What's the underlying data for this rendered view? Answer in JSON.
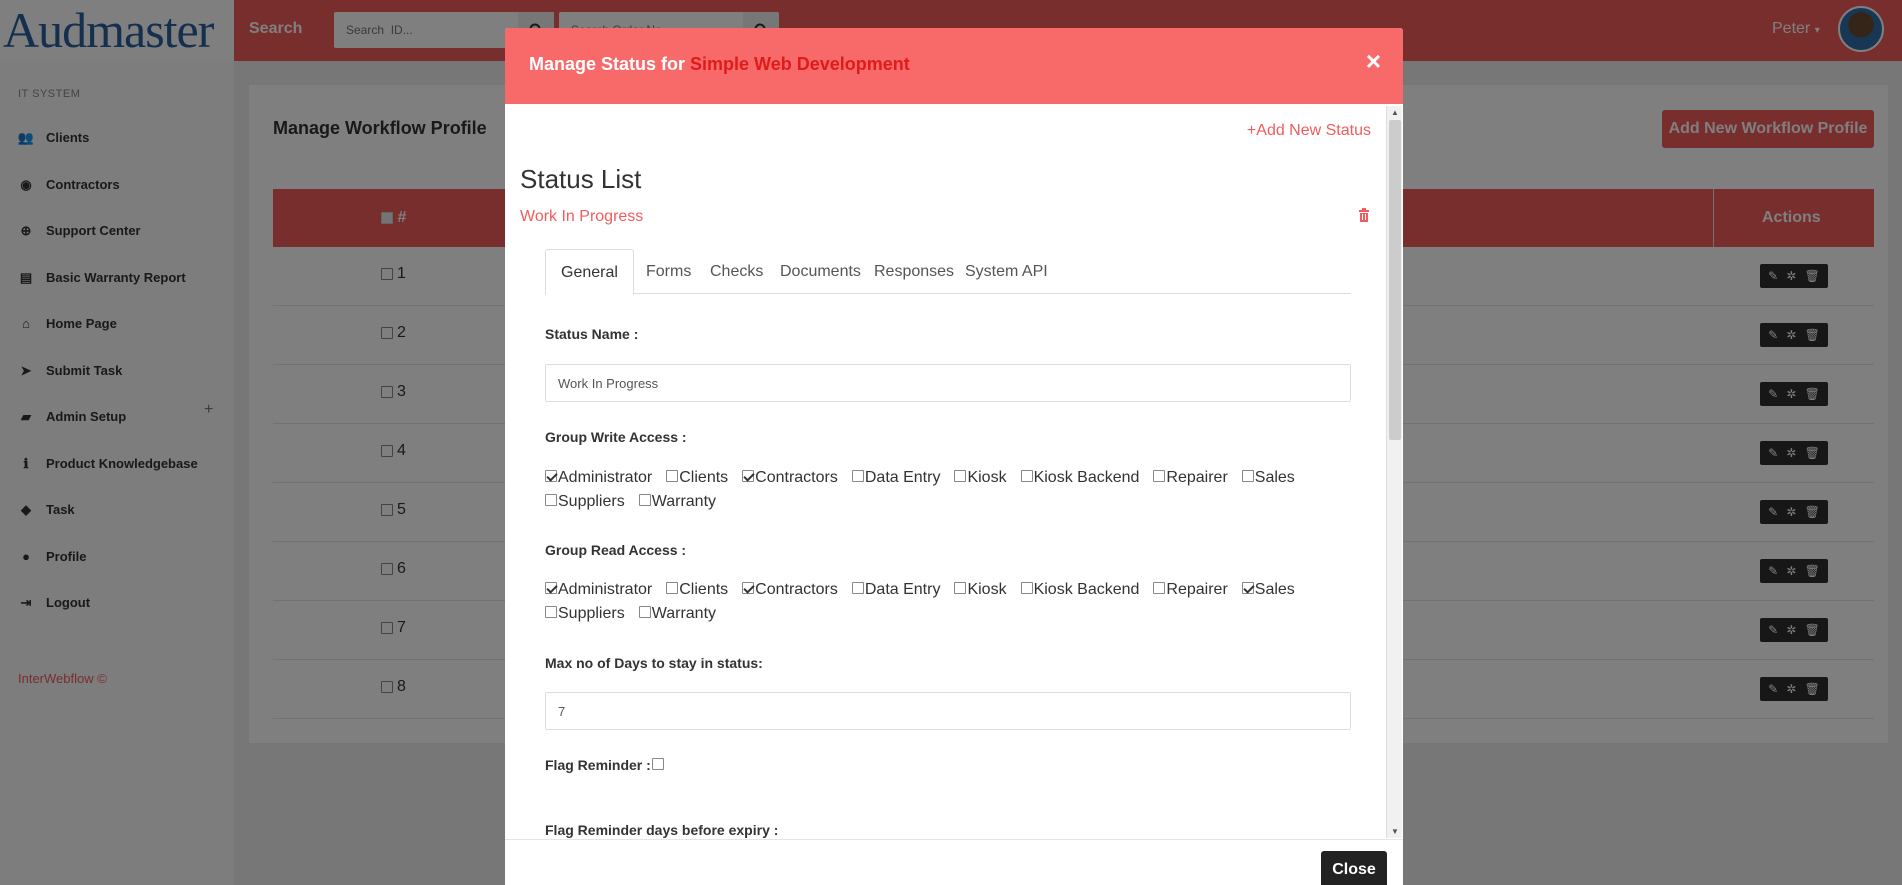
{
  "app": {
    "logo_text": "Audmaster"
  },
  "topbar": {
    "search_label": "Search",
    "search_id_placeholder": "Search  ID...",
    "search_order_placeholder": "Search Order No",
    "user_name": "Peter"
  },
  "sidebar": {
    "heading": "IT SYSTEM",
    "items": [
      {
        "label": "Clients",
        "icon": "users-icon"
      },
      {
        "label": "Contractors",
        "icon": "user-circle-icon"
      },
      {
        "label": "Support Center",
        "icon": "life-ring-icon"
      },
      {
        "label": "Basic Warranty Report",
        "icon": "file-icon"
      },
      {
        "label": "Home Page",
        "icon": "home-icon"
      },
      {
        "label": "Submit Task",
        "icon": "paper-plane-icon"
      },
      {
        "label": "Admin Setup",
        "icon": "folder-icon"
      },
      {
        "label": "Product Knowledgebase",
        "icon": "info-icon"
      },
      {
        "label": "Task",
        "icon": "tag-icon"
      },
      {
        "label": "Profile",
        "icon": "user-icon"
      },
      {
        "label": "Logout",
        "icon": "sign-out-icon"
      }
    ],
    "expand_symbol": "+",
    "footer": "InterWebflow ©"
  },
  "main": {
    "title": "Manage Workflow Profile",
    "add_button": "Add New Workflow Profile",
    "columns": {
      "num": "#",
      "actions": "Actions"
    },
    "rows": [
      "1",
      "2",
      "3",
      "4",
      "5",
      "6",
      "7",
      "8"
    ]
  },
  "modal": {
    "title_prefix": "Manage Status for ",
    "title_project": "Simple Web Development",
    "close_symbol": "×",
    "add_status": "+Add New Status",
    "status_list_title": "Status List",
    "status_item": "Work In Progress",
    "tabs": [
      "General",
      "Forms",
      "Checks",
      "Documents",
      "Responses",
      "System API"
    ],
    "status_name_label": "Status Name :",
    "status_name_value": "Work In Progress",
    "write_access_label": "Group Write Access :",
    "write_access": [
      {
        "label": "Administrator",
        "checked": true
      },
      {
        "label": "Clients",
        "checked": false
      },
      {
        "label": "Contractors",
        "checked": true
      },
      {
        "label": "Data Entry",
        "checked": false
      },
      {
        "label": "Kiosk",
        "checked": false
      },
      {
        "label": "Kiosk Backend",
        "checked": false
      },
      {
        "label": "Repairer",
        "checked": false
      },
      {
        "label": "Sales",
        "checked": false
      },
      {
        "label": "Suppliers",
        "checked": false
      },
      {
        "label": "Warranty",
        "checked": false
      }
    ],
    "read_access_label": "Group Read Access :",
    "read_access": [
      {
        "label": "Administrator",
        "checked": true
      },
      {
        "label": "Clients",
        "checked": false
      },
      {
        "label": "Contractors",
        "checked": true
      },
      {
        "label": "Data Entry",
        "checked": false
      },
      {
        "label": "Kiosk",
        "checked": false
      },
      {
        "label": "Kiosk Backend",
        "checked": false
      },
      {
        "label": "Repairer",
        "checked": false
      },
      {
        "label": "Sales",
        "checked": true
      },
      {
        "label": "Suppliers",
        "checked": false
      },
      {
        "label": "Warranty",
        "checked": false
      }
    ],
    "max_days_label": "Max no of Days to stay in status:",
    "max_days_value": "7",
    "flag_reminder_label": "Flag Reminder :",
    "flag_reminder_checked": false,
    "flag_days_label": "Flag Reminder days before expiry :",
    "close_button": "Close"
  },
  "colors": {
    "accent": "#f25c5c",
    "modal_header": "#f86a6a",
    "project_red": "#e01b1b"
  }
}
